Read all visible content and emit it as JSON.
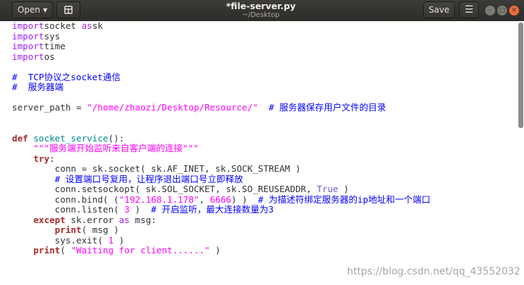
{
  "window": {
    "title": "*file-server.py",
    "subtitle": "~/Desktop",
    "open_label": "Open",
    "save_label": "Save"
  },
  "watermark": "https://blog.csdn.net/qq_43552032",
  "code_lines": [
    [
      [
        "kw",
        "import"
      ],
      [
        "",
        "socket "
      ],
      [
        "kw",
        "as"
      ],
      [
        "",
        "sk"
      ]
    ],
    [
      [
        "kw",
        "import"
      ],
      [
        "",
        "sys"
      ]
    ],
    [
      [
        "kw",
        "import"
      ],
      [
        "",
        "time"
      ]
    ],
    [
      [
        "kw",
        "import"
      ],
      [
        "",
        "os"
      ]
    ],
    [],
    [
      [
        "cm",
        "#  TCP协议之socket通信"
      ]
    ],
    [
      [
        "cm",
        "#  服务器端"
      ]
    ],
    [],
    [
      [
        "",
        "server_path = "
      ],
      [
        "str",
        "\"/home/zhaozi/Desktop/Resource/\""
      ],
      [
        "",
        "  "
      ],
      [
        "cm",
        "# 服务器保存用户文件的目录"
      ]
    ],
    [],
    [],
    [
      [
        "kwb",
        "def"
      ],
      [
        "",
        ""
      ],
      [
        "fn",
        " socket_service"
      ],
      [
        "",
        "():"
      ]
    ],
    [
      [
        "",
        "    "
      ],
      [
        "str",
        "\"\"\"服务端开始监听来自客户端的连接\"\"\""
      ]
    ],
    [
      [
        "",
        "    "
      ],
      [
        "kwb",
        "try"
      ],
      [
        "",
        ":"
      ]
    ],
    [
      [
        "",
        "        conn = sk.socket( sk.AF_INET, sk.SOCK_STREAM )"
      ]
    ],
    [
      [
        "",
        "        "
      ],
      [
        "cm",
        "# 设置端口号复用，让程序退出端口号立即释放"
      ]
    ],
    [
      [
        "",
        "        conn.setsockopt( sk.SOL_SOCKET, sk.SO_REUSEADDR, "
      ],
      [
        "const",
        "True"
      ],
      [
        "",
        " )"
      ]
    ],
    [
      [
        "",
        "        conn.bind( ("
      ],
      [
        "str",
        "\"192.168.1.178\""
      ],
      [
        "",
        ", "
      ],
      [
        "num",
        "6666"
      ],
      [
        "",
        ") )  "
      ],
      [
        "cm",
        "# 为描述符绑定服务器的ip地址和一个端口"
      ]
    ],
    [
      [
        "",
        "        conn.listen( "
      ],
      [
        "num",
        "3"
      ],
      [
        "",
        " )  "
      ],
      [
        "cm",
        "# 开启监听，最大连接数量为3"
      ]
    ],
    [
      [
        "",
        "    "
      ],
      [
        "kwb",
        "except"
      ],
      [
        "",
        " sk.error "
      ],
      [
        "kw",
        "as"
      ],
      [
        "",
        " msg:"
      ]
    ],
    [
      [
        "",
        "        "
      ],
      [
        "kwb",
        "print"
      ],
      [
        "",
        "( msg )"
      ]
    ],
    [
      [
        "",
        "        sys.exit( "
      ],
      [
        "num",
        "1"
      ],
      [
        "",
        " )"
      ]
    ],
    [
      [
        "",
        "    "
      ],
      [
        "kwb",
        "print"
      ],
      [
        "",
        "( "
      ],
      [
        "str",
        "\"Waiting for client......\""
      ],
      [
        "",
        " )"
      ]
    ]
  ]
}
